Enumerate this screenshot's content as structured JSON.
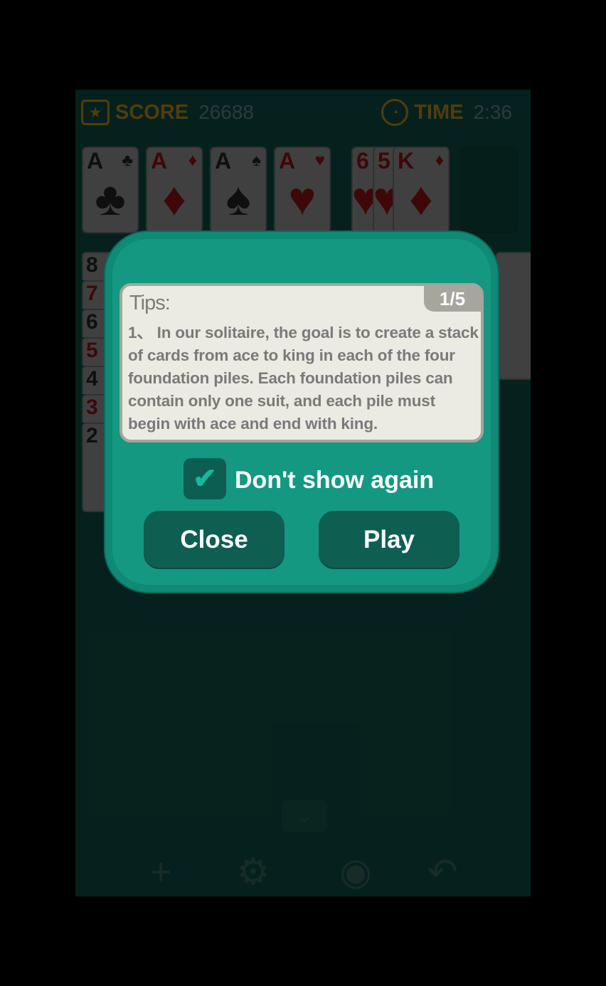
{
  "hud": {
    "score_label": "SCORE",
    "score_value": "26688",
    "time_label": "TIME",
    "time_value": "2:36"
  },
  "foundation": [
    {
      "rank": "A",
      "suit": "♣",
      "color": "black"
    },
    {
      "rank": "A",
      "suit": "♦",
      "color": "red"
    },
    {
      "rank": "A",
      "suit": "♠",
      "color": "black"
    },
    {
      "rank": "A",
      "suit": "♥",
      "color": "red"
    }
  ],
  "waste": [
    {
      "rank": "6",
      "suit": "♥",
      "color": "red"
    },
    {
      "rank": "5",
      "suit": "♥",
      "color": "red"
    },
    {
      "rank": "K",
      "suit": "♦",
      "color": "red"
    }
  ],
  "tableau_column": [
    "8",
    "7",
    "6",
    "5",
    "4",
    "3",
    "2"
  ],
  "dialog": {
    "title": "Tips:",
    "page": "1/5",
    "text": "1、 In our solitaire, the goal is to create a stack of cards from ace to king in each of the four foundation piles. Each foundation piles can contain only one suit, and each pile must begin with ace and end with king.",
    "checkbox_label": "Don't show again",
    "close_label": "Close",
    "play_label": "Play"
  },
  "toolbar_icons": [
    "plus-icon",
    "gear-icon",
    "lightbulb-icon",
    "undo-icon"
  ]
}
